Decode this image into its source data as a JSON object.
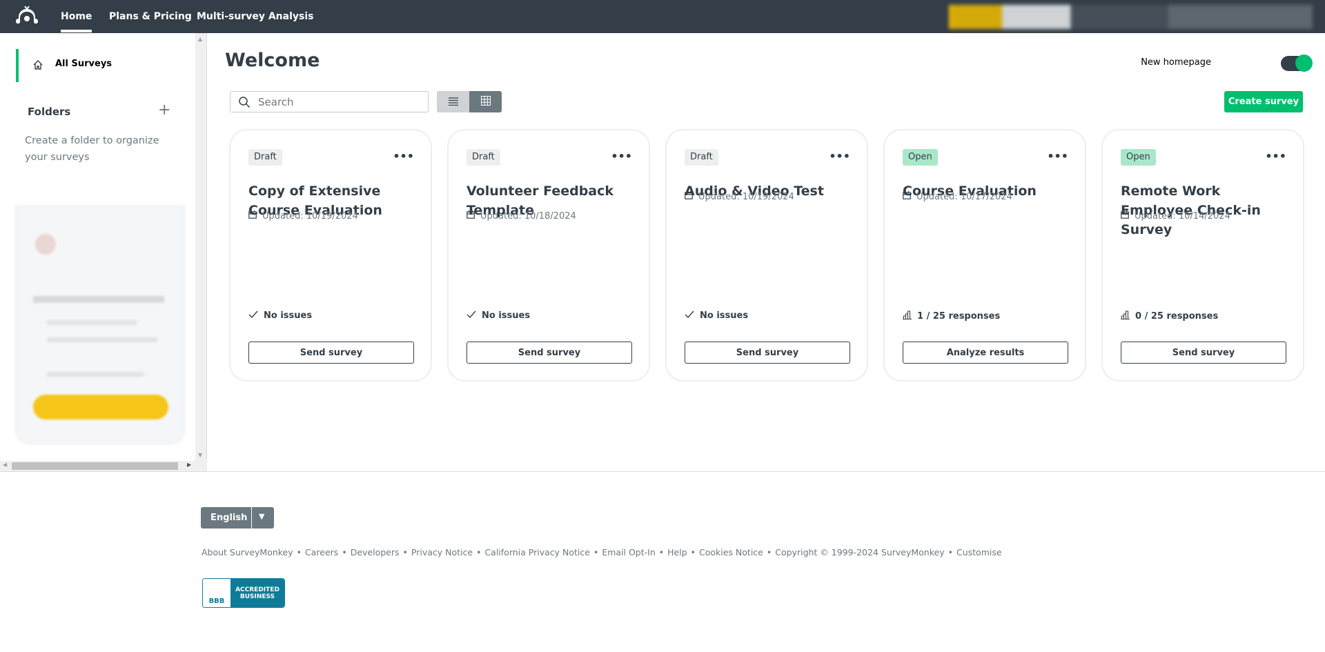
{
  "nav": {
    "items": [
      "Home",
      "Plans & Pricing",
      "Multi-survey Analysis"
    ]
  },
  "sidebar": {
    "all_surveys": "All Surveys",
    "folders": "Folders",
    "folders_hint": "Create a folder to organize your surveys"
  },
  "main": {
    "title": "Welcome",
    "new_homepage_label": "New homepage",
    "new_homepage_on": true,
    "search_placeholder": "Search",
    "create_label": "Create survey",
    "view_mode": "grid"
  },
  "cards": [
    {
      "status": "Draft",
      "title": "Copy of Extensive Course Evaluation",
      "updated": "Updated: 10/19/2024",
      "info": "No issues",
      "info_icon": "check",
      "action": "Send survey"
    },
    {
      "status": "Draft",
      "title": "Volunteer Feedback Template",
      "updated": "Updated: 10/18/2024",
      "info": "No issues",
      "info_icon": "check",
      "action": "Send survey"
    },
    {
      "status": "Draft",
      "title": "Audio & Video Test",
      "updated": "Updated: 10/19/2024",
      "info": "No issues",
      "info_icon": "check",
      "action": "Send survey"
    },
    {
      "status": "Open",
      "title": "Course Evaluation",
      "updated": "Updated: 10/17/2024",
      "info": "1 / 25 responses",
      "info_icon": "bar-chart",
      "action": "Analyze results"
    },
    {
      "status": "Open",
      "title": "Remote Work Employee Check-in Survey",
      "updated": "Updated: 10/14/2024",
      "info": "0 / 25 responses",
      "info_icon": "bar-chart",
      "action": "Send survey"
    }
  ],
  "colors": {
    "brand": "#00bf6f",
    "topbar": "#333e48",
    "draft_badge": "#edeeee",
    "open_badge": "#a8e8c9"
  },
  "footer": {
    "language": "English",
    "links": [
      "About SurveyMonkey",
      "Careers",
      "Developers",
      "Privacy Notice",
      "California Privacy Notice",
      "Email Opt-In",
      "Help",
      "Cookies Notice",
      "Copyright © 1999-2024 SurveyMonkey",
      "Customise"
    ],
    "bbb_text": "ACCREDITED BUSINESS",
    "bbb_logo": "BBB"
  }
}
